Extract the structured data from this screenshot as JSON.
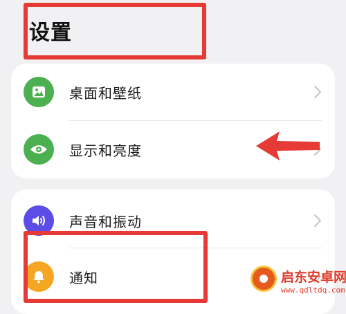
{
  "page": {
    "title": "设置"
  },
  "groups": [
    {
      "items": [
        {
          "label": "桌面和壁纸",
          "icon": "image-icon",
          "icon_color": "#4caf50"
        },
        {
          "label": "显示和亮度",
          "icon": "eye-icon",
          "icon_color": "#4caf50"
        }
      ]
    },
    {
      "items": [
        {
          "label": "声音和振动",
          "icon": "volume-icon",
          "icon_color": "#5b4de6"
        },
        {
          "label": "通知",
          "icon": "bell-icon",
          "icon_color": "#f5a623"
        }
      ]
    }
  ],
  "annotation": {
    "color": "#e53a35"
  },
  "watermark": {
    "name": "启东安卓网",
    "url": "www.qdltdq.com"
  }
}
